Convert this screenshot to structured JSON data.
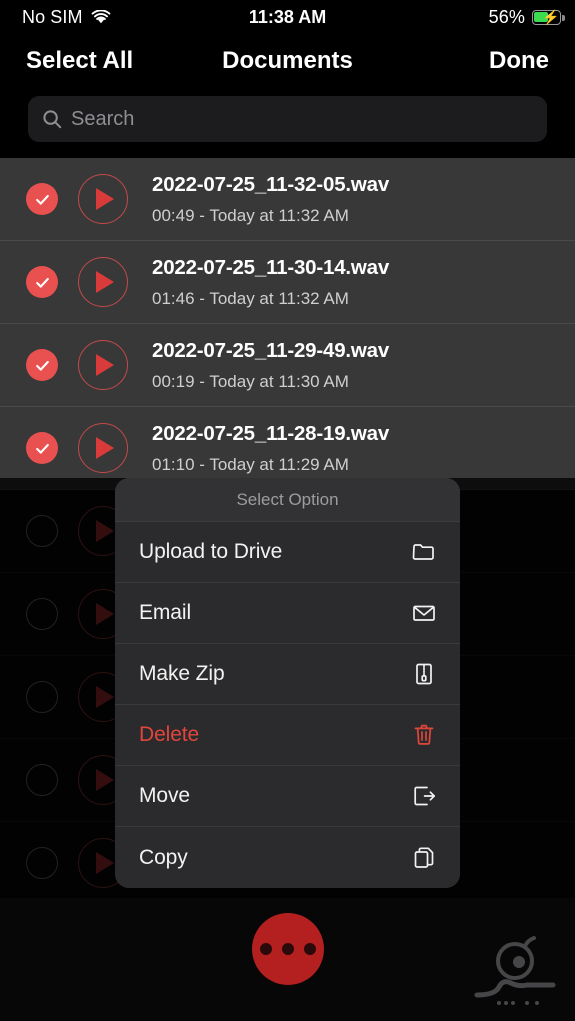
{
  "status_bar": {
    "carrier": "No SIM",
    "wifi_icon": "wifi-icon",
    "time": "11:38 AM",
    "battery_percent": "56%",
    "battery_icon": "battery-charging-icon",
    "battery_level": 56
  },
  "nav_bar": {
    "select_all": "Select All",
    "title": "Documents",
    "done": "Done"
  },
  "search": {
    "placeholder": "Search",
    "value": "",
    "icon": "search-icon"
  },
  "file_list": [
    {
      "name": "2022-07-25_11-32-05.wav",
      "sub": "00:49 - Today at 11:32 AM",
      "selected": true,
      "dim": false
    },
    {
      "name": "2022-07-25_11-30-14.wav",
      "sub": "01:46 - Today at 11:32 AM",
      "selected": true,
      "dim": false
    },
    {
      "name": "2022-07-25_11-29-49.wav",
      "sub": "00:19 - Today at 11:30 AM",
      "selected": true,
      "dim": false
    },
    {
      "name": "2022-07-25_11-28-19.wav",
      "sub": "01:10 - Today at 11:29 AM",
      "selected": true,
      "dim": false
    },
    {
      "name": "",
      "sub": "",
      "selected": false,
      "dim": true
    },
    {
      "name": "",
      "sub": "",
      "selected": false,
      "dim": true
    },
    {
      "name": "",
      "sub": "",
      "selected": false,
      "dim": true
    },
    {
      "name": "",
      "sub": "",
      "selected": false,
      "dim": true
    },
    {
      "name": "",
      "sub": "",
      "selected": false,
      "dim": true
    }
  ],
  "action_sheet": {
    "title": "Select Option",
    "items": [
      {
        "label": "Upload to Drive",
        "icon": "folder-icon",
        "destructive": false
      },
      {
        "label": "Email",
        "icon": "envelope-icon",
        "destructive": false
      },
      {
        "label": "Make Zip",
        "icon": "zip-file-icon",
        "destructive": false
      },
      {
        "label": "Delete",
        "icon": "trash-icon",
        "destructive": true
      },
      {
        "label": "Move",
        "icon": "export-icon",
        "destructive": false
      },
      {
        "label": "Copy",
        "icon": "copy-icon",
        "destructive": false
      }
    ]
  },
  "bottom_bar": {
    "more_button_icon": "ellipsis-icon",
    "watermark": "sibche-logo"
  },
  "colors": {
    "accent_red": "#d93a3a",
    "checkbox_red": "#e8514f",
    "destructive_red": "#e1453c",
    "fab_red": "#b3201f",
    "row_bg": "#383838",
    "sheet_bg": "#2b2b2d",
    "battery_green": "#3ddc50"
  }
}
